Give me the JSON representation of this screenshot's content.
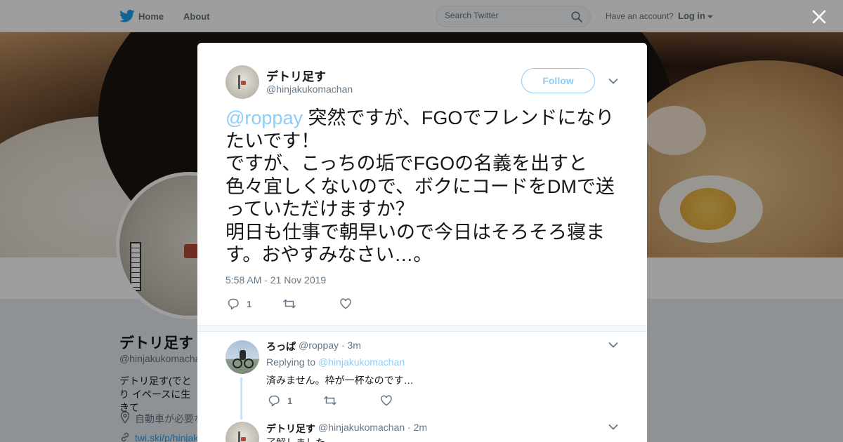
{
  "nav": {
    "home": "Home",
    "about": "About",
    "search_placeholder": "Search Twitter",
    "have_account": "Have an account?",
    "login": "Log in"
  },
  "profile": {
    "name": "デトリ足す",
    "handle": "@hinjakukomachan",
    "bio": "デトリ足す(でとり イペースに生きて",
    "location": "自動車が必要な",
    "link": "twi.ski/p/hinjak"
  },
  "tweet": {
    "name": "デトリ足す",
    "handle": "@hinjakukomachan",
    "follow_label": "Follow",
    "mention": "@roppay",
    "text": " 突然ですが、FGOでフレンドになりたいです！\nですが、こっちの垢でFGOの名義を出すと色々宜しくないので、ボクにコードをDMで送っていただけますか？\n明日も仕事で朝早いので今日はそろそろ寝ます。おやすみなさい…。",
    "timestamp": "5:58 AM - 21 Nov 2019",
    "reply_count": "1"
  },
  "replies": [
    {
      "name": "ろっぱ",
      "handle": "@roppay · 3m",
      "replying_to_prefix": "Replying to",
      "replying_to": "@hinjakukomachan",
      "text": "済みません。枠が一杯なのです…",
      "reply_count": "1"
    },
    {
      "name": "デトリ足す",
      "handle": "@hinjakukomachan · 2m",
      "text": "了解しました"
    }
  ],
  "icons": [
    "twitter-bird-icon",
    "search-icon",
    "close-icon",
    "chevron-down-icon",
    "reply-icon",
    "retweet-icon",
    "heart-icon",
    "location-icon",
    "link-icon"
  ],
  "colors": {
    "accent": "#1da1f2",
    "accent_light": "#8ecdf7",
    "secondary_text": "#657786"
  }
}
